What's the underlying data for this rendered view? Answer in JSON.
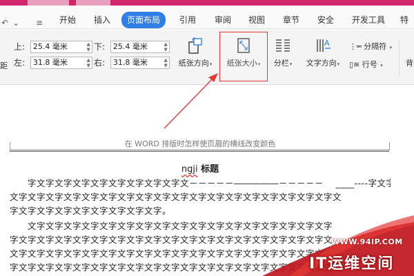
{
  "menu": {
    "quick_access": [
      "↶",
      "⌄",
      "≡"
    ],
    "tabs": [
      {
        "label": "开始",
        "active": false
      },
      {
        "label": "插入",
        "active": false
      },
      {
        "label": "页面布局",
        "active": true
      },
      {
        "label": "引用",
        "active": false
      },
      {
        "label": "审阅",
        "active": false
      },
      {
        "label": "视图",
        "active": false
      },
      {
        "label": "章节",
        "active": false
      },
      {
        "label": "安全",
        "active": false
      },
      {
        "label": "开发工具",
        "active": false
      },
      {
        "label": "特",
        "active": false
      }
    ]
  },
  "ribbon": {
    "margins": {
      "top": {
        "label": "上:",
        "value": "25.4 毫米"
      },
      "bottom": {
        "label": "下:",
        "value": "25.4 毫米"
      },
      "left": {
        "label": "左:",
        "value": "31.8 毫米"
      },
      "right": {
        "label": "右:",
        "value": "31.8 毫米"
      },
      "edge_left": "距"
    },
    "orientation_label": "纸张方向",
    "size_label": "纸张大小",
    "columns_label": "分栏",
    "text_direction_label": "文字方向",
    "separator_label": "分隔符",
    "line_number_label": "行号",
    "edge_right": "背"
  },
  "document": {
    "header_text": "在 WORD 排版时怎样使页眉的横线改变颜色",
    "title_prefix": "ngji",
    "title": "标题",
    "lines": [
      "　　字文字文字文字文字文字文字文字文字文－－－－－―――――－－－－－ 　____----字文字",
      "文字文字文字文字文字文字文字文字文字文字文字文字文字文字文字文字文字文字文",
      "字文字文字文字文字文字文字文字文字。",
      "　　文字文字文字文字文字文字文字文字文字文字文字文字文字文字文字文字文字",
      "字文字文字文字文字文字文字文字文字文字文字文字文字文字文字文字文字文字文",
      "文字文字文字文字文字文字文字文字文字文字文字文字文字文字文字文字文字文字",
      "字文字文字文字文字文字文字文字文字文字文字文字文字文字文字文字文字文字文"
    ]
  },
  "watermark": {
    "url": "WWW.94IP.COM",
    "brand": "IT运维空间"
  },
  "colors": {
    "accent": "#2f7fe6",
    "highlight": "#e53935",
    "title_strip": "#d0256b"
  }
}
